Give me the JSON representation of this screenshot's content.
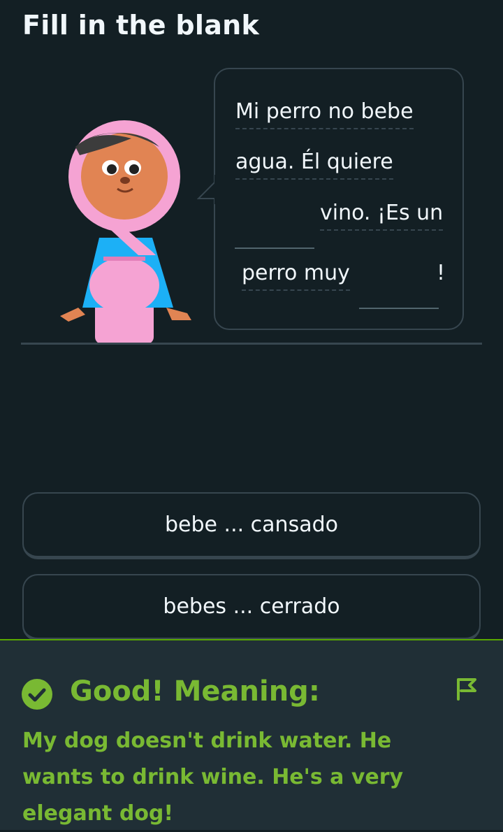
{
  "header": {
    "title": "Fill in the blank"
  },
  "sentence": {
    "l1": "Mi perro no bebe",
    "l2": "agua. Él quiere",
    "l3": "vino. ¡Es un",
    "l4": "perro muy",
    "end": "!"
  },
  "options": [
    {
      "label": "bebe ... cansado"
    },
    {
      "label": "bebes ... cerrado"
    }
  ],
  "feedback": {
    "title": "Good! Meaning:",
    "text": "My dog doesn't drink water. He wants to drink wine. He's a very elegant dog!",
    "accent": "#79b933"
  }
}
